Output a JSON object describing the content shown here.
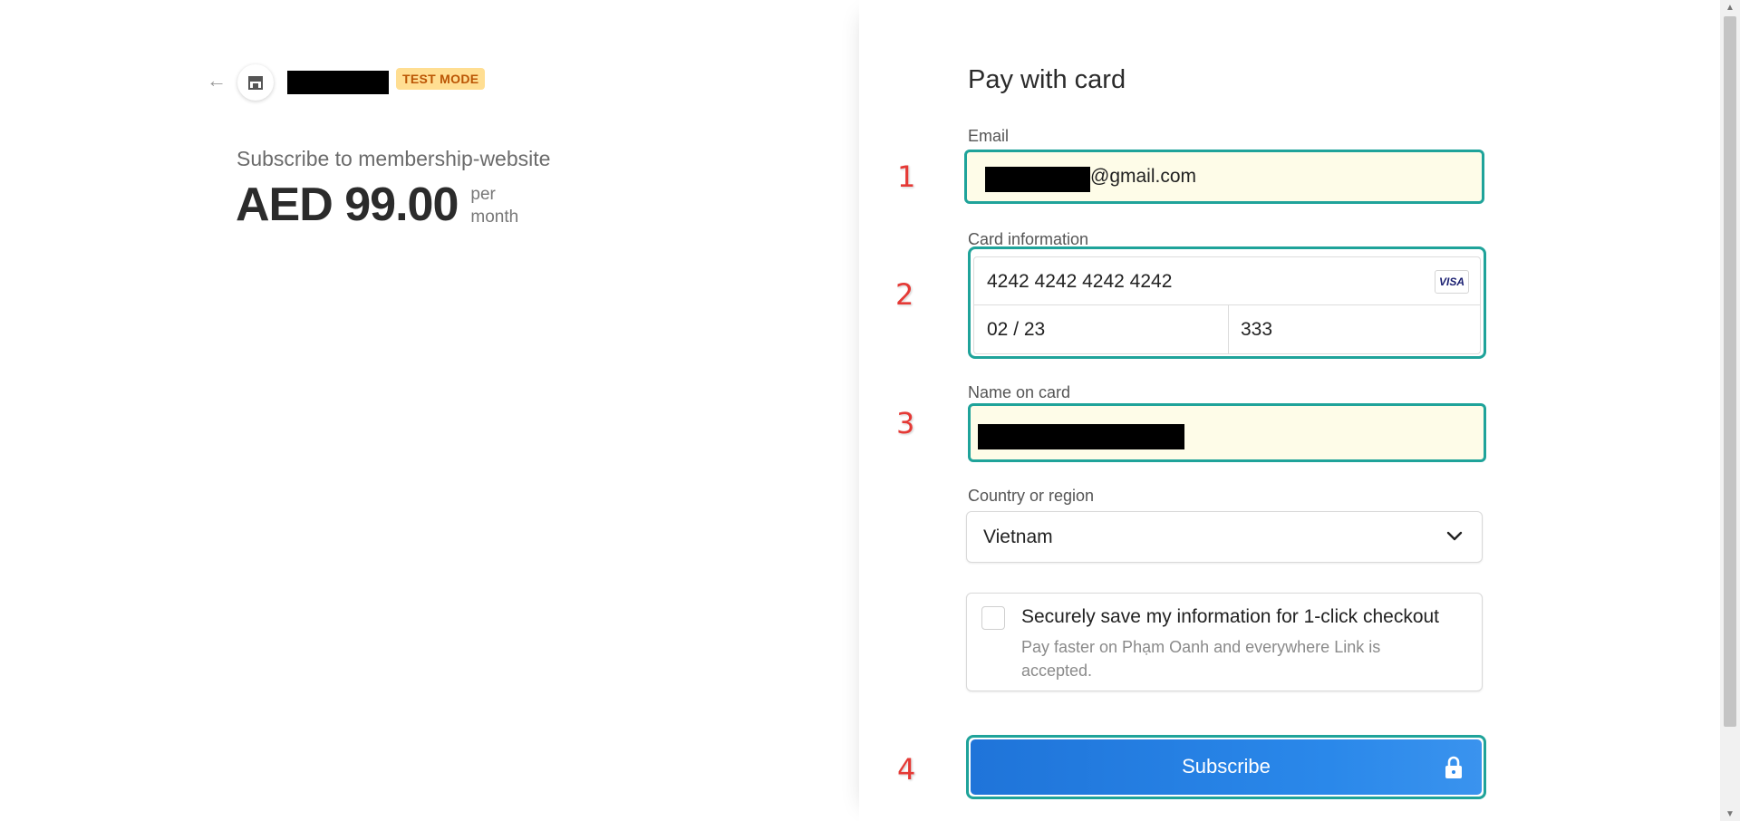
{
  "header": {
    "back_icon": "arrow-left-icon",
    "store_icon": "store-icon",
    "badge": "TEST MODE"
  },
  "product": {
    "title": "Subscribe to membership-website",
    "price": "AED 99.00",
    "period_line1": "per",
    "period_line2": "month"
  },
  "form": {
    "title": "Pay with card",
    "email": {
      "label": "Email",
      "value_suffix": "@gmail.com"
    },
    "card": {
      "label": "Card information",
      "number": "4242 4242 4242 4242",
      "brand": "VISA",
      "expiry": "02 / 23",
      "cvc": "333"
    },
    "name": {
      "label": "Name on card"
    },
    "country": {
      "label": "Country or region",
      "value": "Vietnam"
    },
    "save": {
      "title": "Securely save my information for 1-click checkout",
      "description": "Pay faster on Phạm Oanh and everywhere Link is accepted."
    },
    "submit_label": "Subscribe"
  },
  "annotations": [
    "1",
    "2",
    "3",
    "4"
  ],
  "colors": {
    "focus_border": "#1fa39a",
    "autofill_bg": "#fefce8",
    "button_blue": "#2a88ea",
    "annotation_red": "#e53935"
  }
}
